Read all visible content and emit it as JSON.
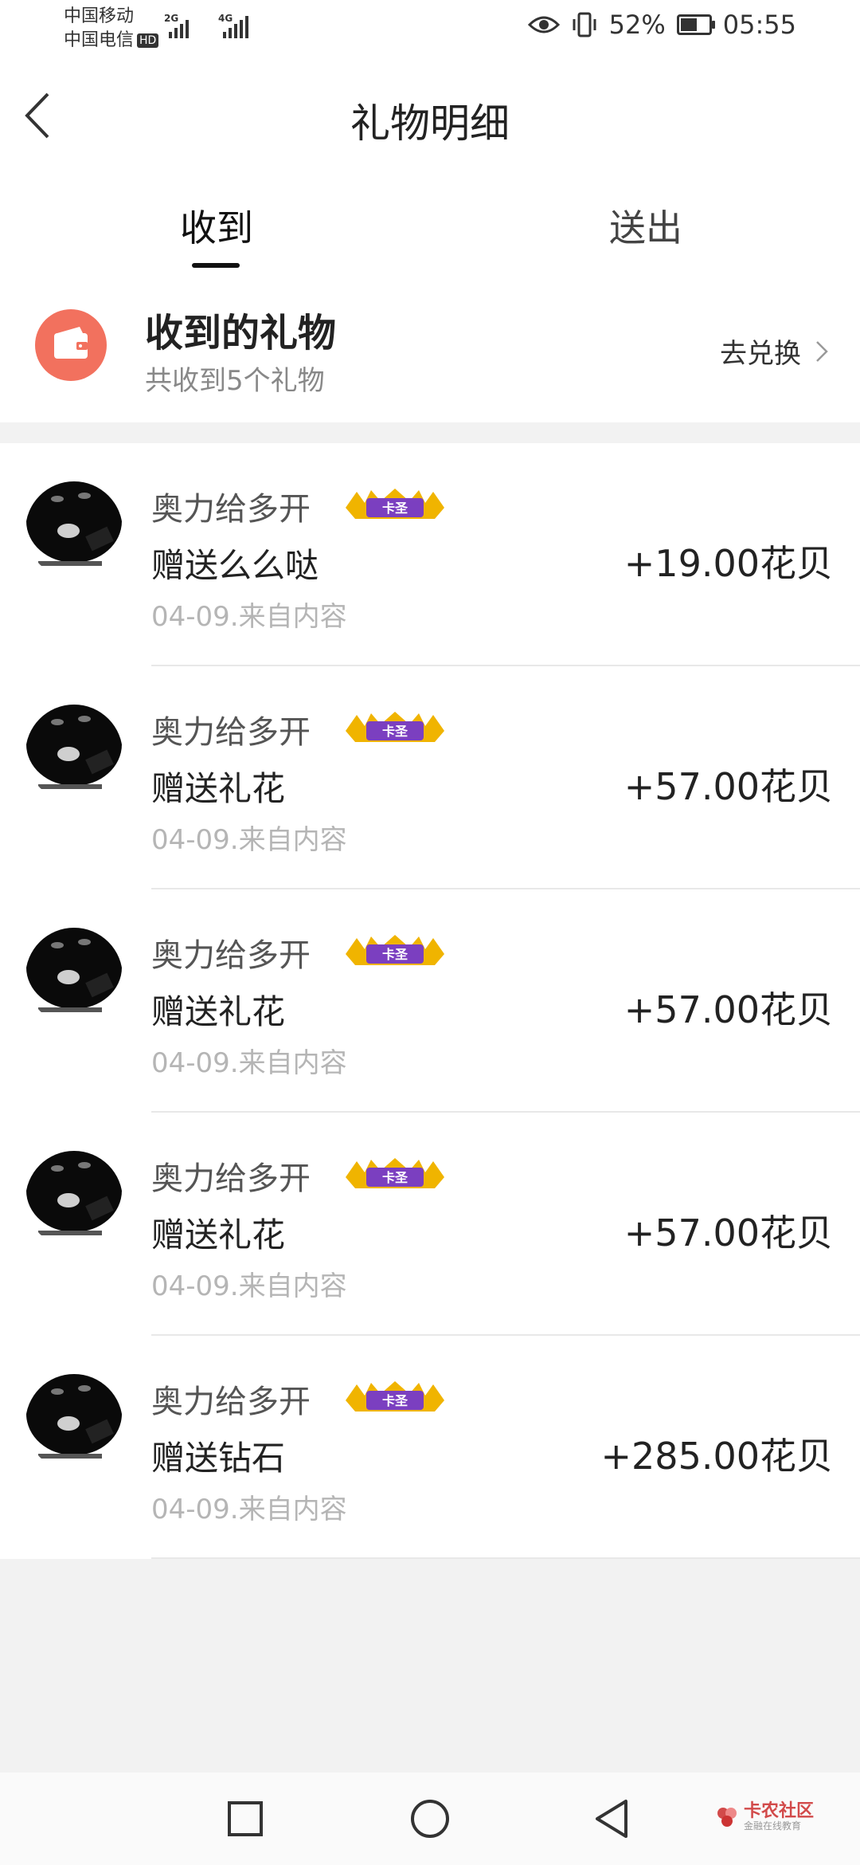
{
  "status_bar": {
    "carrier1": "中国移动",
    "carrier2": "中国电信",
    "hd_badge": "HD",
    "net1": "2G",
    "net2": "4G",
    "battery_pct": "52%",
    "battery_level": 0.52,
    "time": "05:55"
  },
  "header": {
    "title": "礼物明细"
  },
  "tabs": {
    "received": "收到",
    "sent": "送出"
  },
  "summary": {
    "title": "收到的礼物",
    "subtitle": "共收到5个礼物",
    "exchange_label": "去兑换"
  },
  "gifts": [
    {
      "user": "奥力给多开",
      "badge": "卡圣",
      "desc": "赠送么么哒",
      "meta": "04-09.来自内容",
      "amount": "+19.00花贝"
    },
    {
      "user": "奥力给多开",
      "badge": "卡圣",
      "desc": "赠送礼花",
      "meta": "04-09.来自内容",
      "amount": "+57.00花贝"
    },
    {
      "user": "奥力给多开",
      "badge": "卡圣",
      "desc": "赠送礼花",
      "meta": "04-09.来自内容",
      "amount": "+57.00花贝"
    },
    {
      "user": "奥力给多开",
      "badge": "卡圣",
      "desc": "赠送礼花",
      "meta": "04-09.来自内容",
      "amount": "+57.00花贝"
    },
    {
      "user": "奥力给多开",
      "badge": "卡圣",
      "desc": "赠送钻石",
      "meta": "04-09.来自内容",
      "amount": "+285.00花贝"
    }
  ],
  "watermark": {
    "main": "卡农社区",
    "sub": "金融在线教育"
  },
  "icons": {
    "back": "chevron-left-icon",
    "wallet": "wallet-icon",
    "chevron": "chevron-right-icon",
    "eye": "eye-icon",
    "vibrate": "vibrate-icon",
    "nav_recent": "square-icon",
    "nav_home": "circle-icon",
    "nav_back": "triangle-back-icon"
  },
  "colors": {
    "accent": "#f2715e",
    "badge_purple": "#7b3fc0",
    "badge_gold": "#f0b400"
  }
}
